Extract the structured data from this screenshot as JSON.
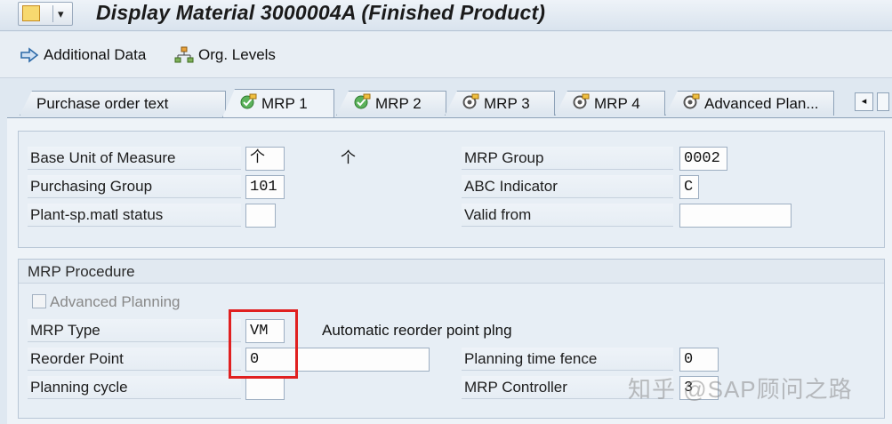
{
  "window": {
    "title": "Display Material 3000004A (Finished Product)",
    "menu_dropdown": "▾"
  },
  "toolbar": {
    "additional_data": "Additional Data",
    "org_levels": "Org. Levels"
  },
  "tabs": [
    {
      "label": "Purchase order text",
      "icon": "none"
    },
    {
      "label": "MRP 1",
      "icon": "check-icon",
      "active": true
    },
    {
      "label": "MRP 2",
      "icon": "check-icon"
    },
    {
      "label": "MRP 3",
      "icon": "gear-icon"
    },
    {
      "label": "MRP 4",
      "icon": "gear-icon"
    },
    {
      "label": "Advanced Plan...",
      "icon": "gear-icon"
    }
  ],
  "tab_nav": {
    "prev": "◂"
  },
  "general": {
    "base_uom_label": "Base Unit of Measure",
    "base_uom_value": "个",
    "base_uom_text": "个",
    "mrp_group_label": "MRP Group",
    "mrp_group_value": "0002",
    "purch_group_label": "Purchasing Group",
    "purch_group_value": "101",
    "abc_label": "ABC Indicator",
    "abc_value": "C",
    "plant_status_label": "Plant-sp.matl status",
    "plant_status_value": "",
    "valid_from_label": "Valid from",
    "valid_from_value": ""
  },
  "mrp_procedure": {
    "title": "MRP Procedure",
    "advanced_planning_label": "Advanced Planning",
    "mrp_type_label": "MRP Type",
    "mrp_type_value": "VM",
    "mrp_type_text": "Automatic reorder point plng",
    "reorder_point_label": "Reorder Point",
    "reorder_point_value": "0",
    "planning_fence_label": "Planning time fence",
    "planning_fence_value": "0",
    "planning_cycle_label": "Planning cycle",
    "planning_cycle_value": "",
    "mrp_controller_label": "MRP Controller",
    "mrp_controller_value": "3"
  },
  "watermark": "知乎 @SAP顾问之路",
  "colors": {
    "highlight": "#e02020",
    "check": "#3a9a3a",
    "gear": "#e0a020"
  }
}
